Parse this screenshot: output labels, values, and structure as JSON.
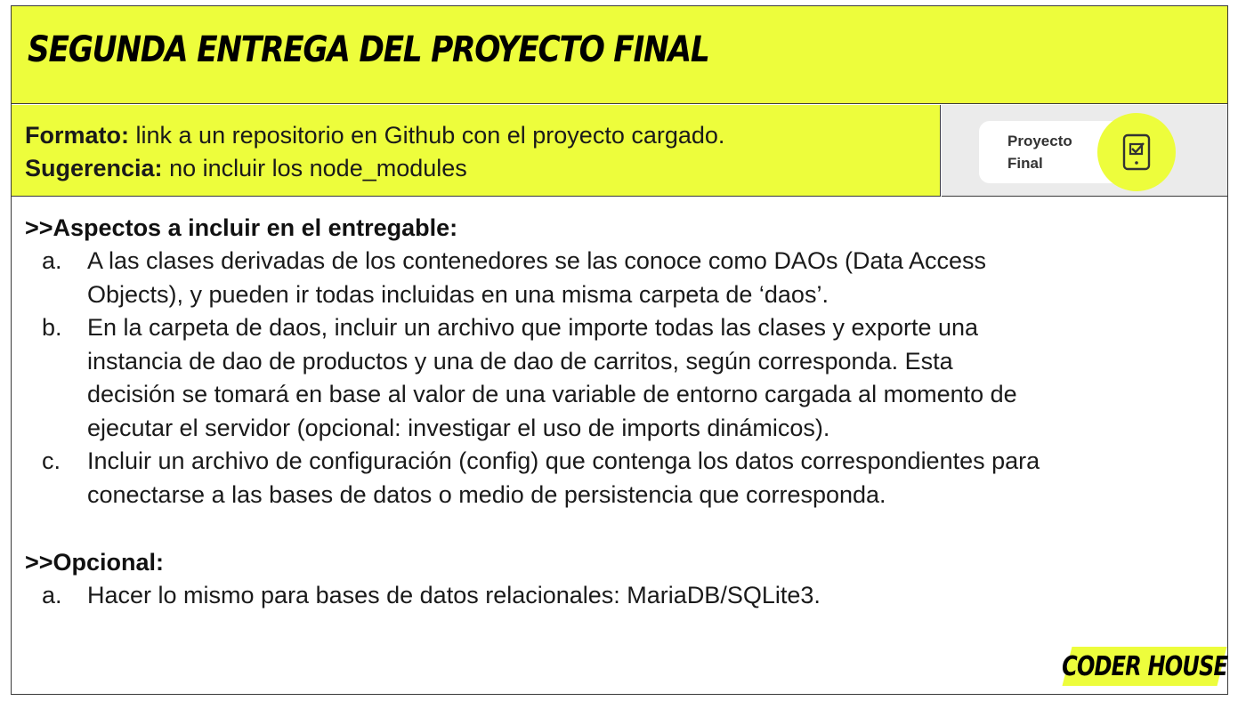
{
  "title": "SEGUNDA ENTREGA DEL PROYECTO FINAL",
  "format": {
    "label": "Formato:",
    "text": "link a un repositorio en Github con el proyecto cargado."
  },
  "suggestion": {
    "label": "Sugerencia:",
    "text": "no incluir los node_modules"
  },
  "badge": {
    "line1": "Proyecto",
    "line2": "Final",
    "icon": "checklist-tablet-icon"
  },
  "aspects": {
    "heading": ">>Aspectos a incluir en el entregable:",
    "items": [
      {
        "marker": "a.",
        "lines": [
          "A las clases derivadas de los contenedores se las conoce como DAOs (Data Access",
          "Objects), y pueden ir todas incluidas en una misma carpeta de ‘daos’."
        ]
      },
      {
        "marker": "b.",
        "lines": [
          "En la carpeta de daos, incluir un archivo que importe todas las clases y exporte una",
          "instancia de dao de productos y una de dao de carritos, según corresponda. Esta",
          "decisión se tomará en base al valor de una variable de entorno cargada al momento de",
          "ejecutar el servidor (opcional: investigar el uso de imports dinámicos)."
        ]
      },
      {
        "marker": "c.",
        "lines": [
          "Incluir un archivo de configuración (config) que contenga los datos correspondientes para",
          "conectarse a las bases de datos o medio de persistencia que corresponda."
        ]
      }
    ]
  },
  "optional": {
    "heading": ">>Opcional:",
    "items": [
      {
        "marker": "a.",
        "lines": [
          "Hacer lo mismo para bases de datos relacionales: MariaDB/SQLite3."
        ]
      }
    ]
  },
  "logo": "CODER HOUSE",
  "colors": {
    "accent": "#edfd3c",
    "text": "#1a1a1a",
    "badge_bg": "#ebebeb"
  }
}
